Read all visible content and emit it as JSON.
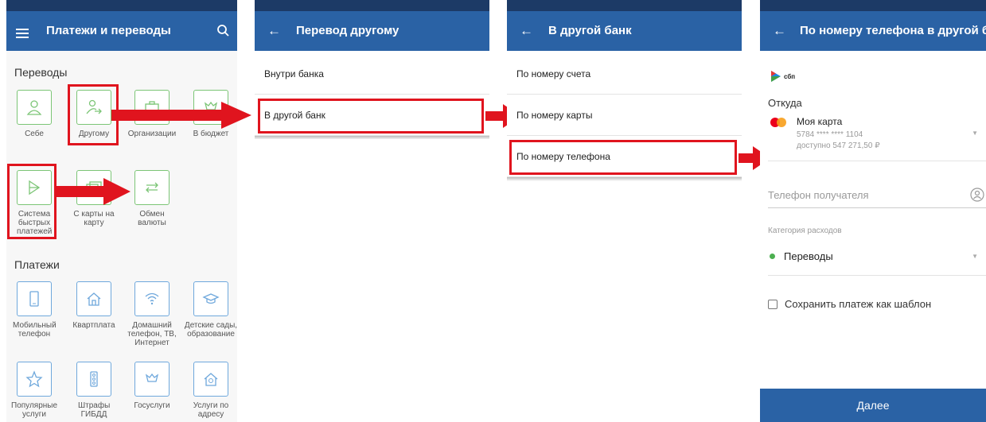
{
  "screen1": {
    "title": "Платежи и переводы",
    "transfers_heading": "Переводы",
    "transfers": [
      {
        "label": "Себе",
        "icon": "person-icon"
      },
      {
        "label": "Другому",
        "icon": "person-arrow-icon"
      },
      {
        "label": "Организации",
        "icon": "briefcase-icon"
      },
      {
        "label": "В бюджет",
        "icon": "emblem-icon"
      },
      {
        "label": "Система быстрых платежей",
        "icon": "sbp-icon"
      },
      {
        "label": "С карты на карту",
        "icon": "cards-icon"
      },
      {
        "label": "Обмен валюты",
        "icon": "exchange-icon"
      }
    ],
    "payments_heading": "Платежи",
    "payments": [
      {
        "label": "Мобильный телефон",
        "icon": "phone-icon"
      },
      {
        "label": "Квартплата",
        "icon": "house-icon"
      },
      {
        "label": "Домашний телефон, ТВ, Интернет",
        "icon": "wifi-icon"
      },
      {
        "label": "Детские сады, образование",
        "icon": "graduation-icon"
      },
      {
        "label": "Популярные услуги",
        "icon": "star-icon"
      },
      {
        "label": "Штрафы ГИБДД",
        "icon": "traffic-light-icon"
      },
      {
        "label": "Госуслуги",
        "icon": "emblem-icon"
      },
      {
        "label": "Услуги по адресу",
        "icon": "house-search-icon"
      }
    ]
  },
  "screen2": {
    "title": "Перевод другому",
    "items": [
      "Внутри банка",
      "В другой банк"
    ]
  },
  "screen3": {
    "title": "В другой банк",
    "items": [
      "По номеру счета",
      "По номеру карты",
      "По номеру телефона"
    ]
  },
  "screen4": {
    "title": "По номеру телефона в другой ба...",
    "sbp_logo": "сбп",
    "from_label": "Откуда",
    "card_name": "Моя карта",
    "card_number": "5784 **** **** 1104",
    "card_balance": "доступно 547 271,50 ₽",
    "phone_placeholder": "Телефон получателя",
    "category_label": "Категория расходов",
    "category_value": "Переводы",
    "save_template": "Сохранить платеж как шаблон",
    "next_button": "Далее"
  },
  "colors": {
    "appbar": "#2a62a5",
    "statusbar": "#1c3a66",
    "highlight": "#e0141e",
    "green": "#7cc576"
  }
}
